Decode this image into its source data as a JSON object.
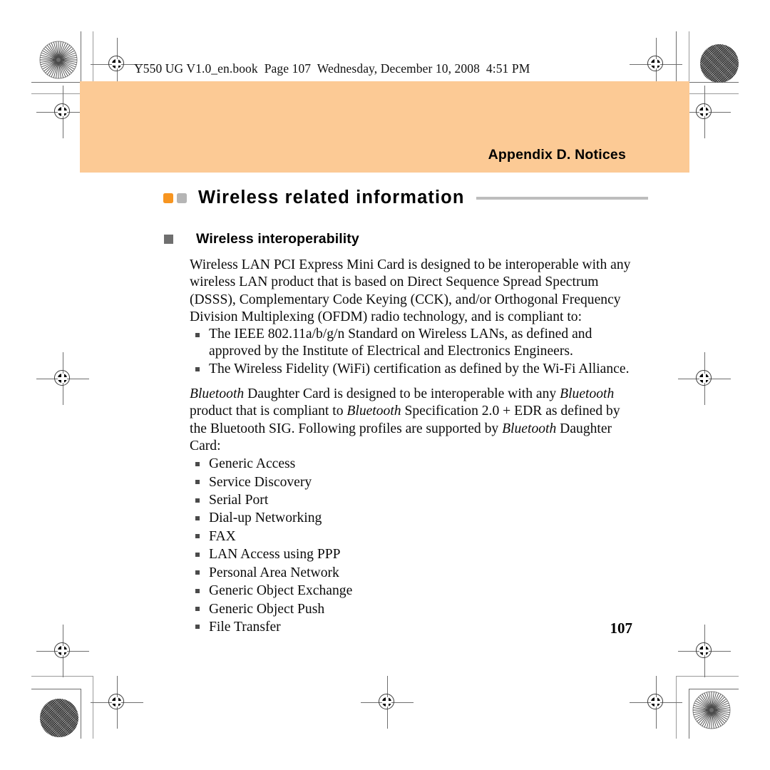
{
  "print_marks": {
    "rosette_icon": "starburst-rosette",
    "halftone_icon": "halftone-circle",
    "registration_icon": "registration-target"
  },
  "header": {
    "book_note": "Y550 UG V1.0_en.book  Page 107  Wednesday, December 10, 2008  4:51 PM"
  },
  "banner": {
    "title": "Appendix D. Notices",
    "color": "#FCCA95"
  },
  "section": {
    "title": "Wireless related information",
    "square_orange": "#F79520",
    "square_gray": "#B5B5B5",
    "rule_color": "#BDBDBD"
  },
  "subsection": {
    "title": "Wireless interoperability",
    "bullet_color": "#6F6F6F"
  },
  "body": {
    "paragraph_1": "Wireless LAN PCI Express Mini Card is designed to be interoperable with any wireless LAN product that is based on Direct Sequence Spread Spectrum (DSSS), Complementary Code Keying (CCK), and/or Orthogonal Frequency Division Multiplexing (OFDM) radio technology, and is compliant to:",
    "standards_list": [
      "The IEEE 802.11a/b/g/n Standard on Wireless LANs, as defined and approved by the Institute of Electrical and Electronics Engineers.",
      "The Wireless Fidelity (WiFi) certification as defined by the Wi-Fi Alliance."
    ],
    "bluetooth_paragraph": {
      "part_1": "Bluetooth",
      "part_2": " Daughter Card is designed to be interoperable with any ",
      "part_3": "Bluetooth",
      "part_4": " product that is compliant to ",
      "part_5": "Bluetooth",
      "part_6": " Specification 2.0 + EDR as defined by the Bluetooth SIG. Following profiles are supported by ",
      "part_7": "Bluetooth",
      "part_8": " Daughter Card:"
    },
    "profiles_list": [
      "Generic Access",
      "Service Discovery",
      "Serial Port",
      "Dial-up Networking",
      "FAX",
      "LAN Access using PPP",
      "Personal Area Network",
      "Generic Object Exchange",
      "Generic Object Push",
      "File Transfer"
    ]
  },
  "footer": {
    "page_number": "107"
  }
}
